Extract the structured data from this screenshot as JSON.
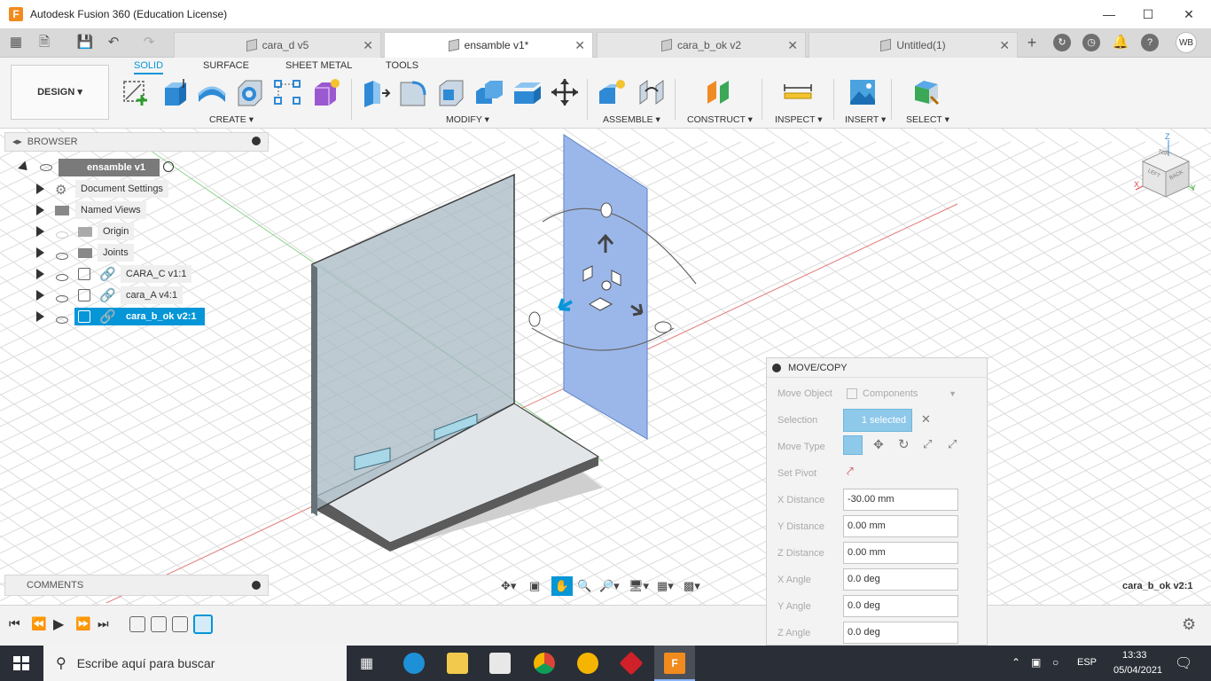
{
  "window": {
    "title": "Autodesk Fusion 360 (Education License)"
  },
  "tabs": [
    {
      "label": "cara_d v5"
    },
    {
      "label": "ensamble v1*"
    },
    {
      "label": "cara_b_ok v2"
    },
    {
      "label": "Untitled(1)"
    }
  ],
  "user_initials": "WB",
  "workspace": {
    "label": "DESIGN"
  },
  "ws_tabs": [
    "SOLID",
    "SURFACE",
    "SHEET METAL",
    "TOOLS"
  ],
  "groups": [
    "CREATE",
    "MODIFY",
    "ASSEMBLE",
    "CONSTRUCT",
    "INSPECT",
    "INSERT",
    "SELECT"
  ],
  "browser": {
    "title": "BROWSER",
    "root": "ensamble v1",
    "items": [
      {
        "label": "Document Settings"
      },
      {
        "label": "Named Views"
      },
      {
        "label": "Origin"
      },
      {
        "label": "Joints"
      },
      {
        "label": "CARA_C v1:1"
      },
      {
        "label": "cara_A v4:1"
      },
      {
        "label": "cara_b_ok v2:1"
      }
    ]
  },
  "comments": {
    "title": "COMMENTS"
  },
  "viewcube": {
    "back": "BACK",
    "left": "LEFT",
    "top": "TOP",
    "x": "X",
    "y": "Y",
    "z": "Z"
  },
  "status": {
    "selection_name": "cara_b_ok v2:1"
  },
  "move_copy": {
    "title": "MOVE/COPY",
    "move_object_label": "Move Object",
    "move_object_value": "Components",
    "selection_label": "Selection",
    "selection_value": "1 selected",
    "move_type_label": "Move Type",
    "set_pivot_label": "Set Pivot",
    "x_distance_label": "X Distance",
    "x_distance_value": "-30.00 mm",
    "y_distance_label": "Y Distance",
    "y_distance_value": "0.00 mm",
    "z_distance_label": "Z Distance",
    "z_distance_value": "0.00 mm",
    "x_angle_label": "X Angle",
    "x_angle_value": "0.0 deg",
    "y_angle_label": "Y Angle",
    "y_angle_value": "0.0 deg",
    "z_angle_label": "Z Angle",
    "z_angle_value": "0.0 deg"
  },
  "taskbar": {
    "search_placeholder": "Escribe aquí para buscar",
    "lang": "ESP",
    "time": "13:33",
    "date": "05/04/2021"
  },
  "colors": {
    "accent": "#0696d7",
    "part_blue": "#9bb7ea",
    "taskbar": "#2a2e36"
  }
}
